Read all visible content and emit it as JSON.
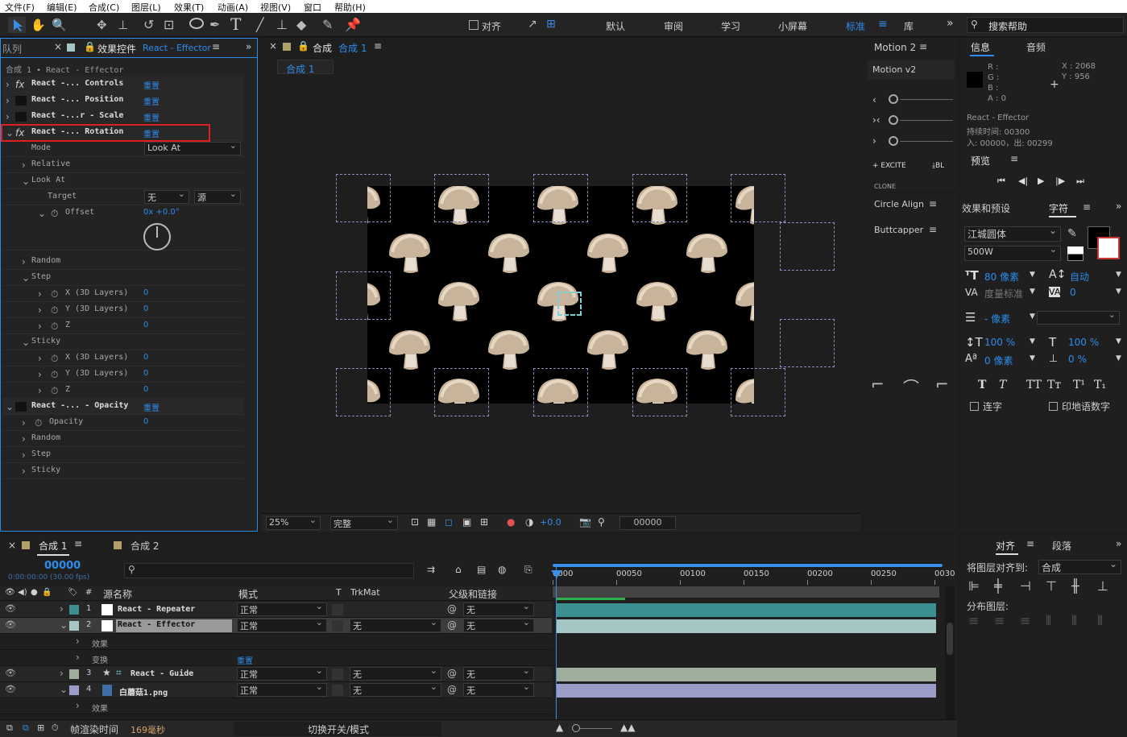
{
  "menu": [
    "文件(F)",
    "编辑(E)",
    "合成(C)",
    "图层(L)",
    "效果(T)",
    "动画(A)",
    "视图(V)",
    "窗口",
    "帮助(H)"
  ],
  "toolbar": {
    "align_label": "对齐",
    "workspaces": [
      "默认",
      "审阅",
      "学习",
      "小屏幕",
      "标准",
      "库"
    ],
    "active_workspace": "标准",
    "search_placeholder": "搜索帮助"
  },
  "effects_panel": {
    "tab_queue": "队列",
    "tab_label": "效果控件",
    "tab_target": "React - Effector",
    "path": "合成 1 • React - Effector",
    "effects": [
      {
        "name": "React -... Controls",
        "reset": "重置"
      },
      {
        "name": "React -... Position",
        "reset": "重置"
      },
      {
        "name": "React -...r - Scale",
        "reset": "重置"
      },
      {
        "name": "React -... Rotation",
        "reset": "重置"
      }
    ],
    "mode_label": "Mode",
    "mode_value": "Look At",
    "relative": "Relative",
    "look_at": "Look At",
    "target_label": "Target",
    "target_val1": "无",
    "target_val2": "源",
    "offset_label": "Offset",
    "offset_value": "0x +0.0°",
    "random": "Random",
    "step": "Step",
    "x3d": "X (3D Layers)",
    "y3d": "Y (3D Layers)",
    "z": "Z",
    "zero": "0",
    "sticky": "Sticky",
    "opacity_effect": "React -... - Opacity",
    "opacity": "Opacity"
  },
  "comp_panel": {
    "tab_label": "合成",
    "tab_name": "合成 1",
    "crumb": "合成 1",
    "zoom": "25%",
    "quality": "完整",
    "exposure": "+0.0",
    "timecode": "00000"
  },
  "scripts": {
    "motion_tab": "Motion 2",
    "motion_title": "Motion v2",
    "excite": "EXCITE",
    "blend": "BL",
    "clone": "CLONE",
    "circle_align": "Circle Align",
    "buttcapper": "Buttcapper"
  },
  "info": {
    "tab_info": "信息",
    "tab_audio": "音频",
    "r": "R :",
    "g": "G :",
    "b": "B :",
    "a": "A : 0",
    "x": "X : 2068",
    "y": "Y : 956",
    "layer": "React - Effector",
    "duration": "持续时间: 00300",
    "in_out": "入: 00000，出: 00299"
  },
  "preview": {
    "tab": "预览"
  },
  "character": {
    "tab_effects": "效果和预设",
    "tab_char": "字符",
    "font": "江城圆体",
    "weight": "500W",
    "size": "80 像素",
    "leading": "自动",
    "kerning": "度量标准",
    "tracking": "0",
    "stroke": "- 像素",
    "vscale": "100 %",
    "hscale": "100 %",
    "baseline": "0 像素",
    "tsume": "0 %",
    "ligatures": "连字",
    "hindi": "印地语数字"
  },
  "align": {
    "tab_align": "对齐",
    "tab_para": "段落",
    "align_to_label": "将图层对齐到:",
    "align_to_value": "合成",
    "distribute": "分布图层:"
  },
  "timeline": {
    "tab1": "合成 1",
    "tab2": "合成 2",
    "timecode": "00000",
    "fps": "0:00:00:00 (30.00 fps)",
    "cols": {
      "source": "源名称",
      "mode": "模式",
      "t": "T",
      "trkmat": "TrkMat",
      "parent": "父级和链接"
    },
    "ticks": [
      "0000",
      "00050",
      "00100",
      "00150",
      "00200",
      "00250",
      "0030"
    ],
    "layers": [
      {
        "num": "1",
        "name": "React - Repeater",
        "mode": "正常",
        "trk": "",
        "parent": "无",
        "color": "#3b8f8f"
      },
      {
        "num": "2",
        "name": "React - Effector",
        "mode": "正常",
        "trk": "无",
        "parent": "无",
        "color": "#a6c6c6"
      },
      {
        "num": "3",
        "name": "React - Guide",
        "mode": "正常",
        "trk": "无",
        "parent": "无",
        "color": "#9fae9a"
      },
      {
        "num": "4",
        "name": "白蘑菇1.png",
        "mode": "正常",
        "trk": "无",
        "parent": "无",
        "color": "#9c9cc8"
      }
    ],
    "effects_sub": "效果",
    "transform_sub": "变换",
    "reset": "重置",
    "render_label": "帧渲染时间",
    "render_time": "169毫秒",
    "switch_label": "切换开关/模式"
  }
}
